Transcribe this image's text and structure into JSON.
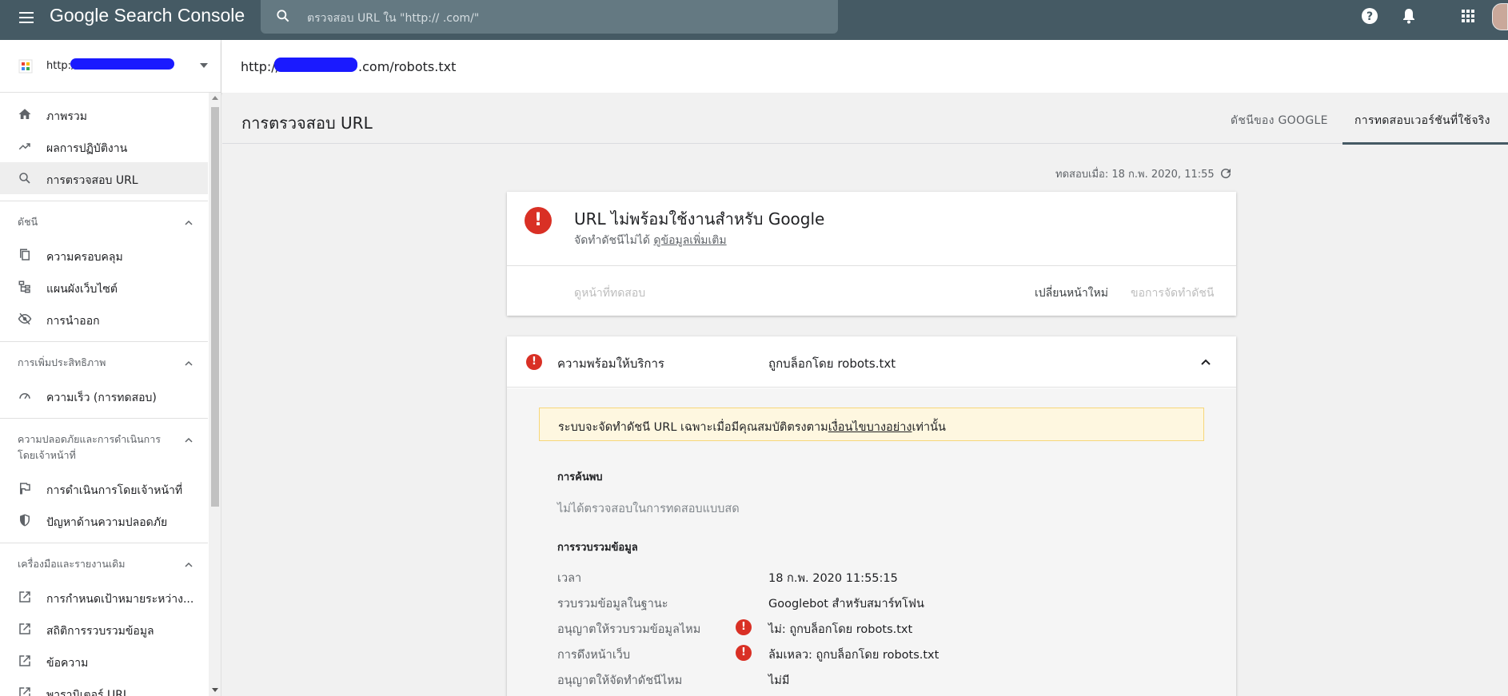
{
  "app": {
    "brand": "Google Search Console"
  },
  "search": {
    "placeholder": "ตรวจสอบ URL ใน \"http://                    .com/\""
  },
  "property": {
    "url": "http://"
  },
  "inspected_url": {
    "prefix": "http://",
    "suffix": ".com/robots.txt"
  },
  "sidebar": {
    "top_items": [
      {
        "label": "ภาพรวม",
        "icon": "home-icon"
      },
      {
        "label": "ผลการปฏิบัติงาน",
        "icon": "trending-up-icon"
      },
      {
        "label": "การตรวจสอบ URL",
        "icon": "search-icon"
      }
    ],
    "sections": [
      {
        "title": "ดัชนี",
        "items": [
          {
            "label": "ความครอบคลุม",
            "icon": "copy-icon"
          },
          {
            "label": "แผนผังเว็บไซต์",
            "icon": "sitemap-icon"
          },
          {
            "label": "การนำออก",
            "icon": "eye-off-icon"
          }
        ]
      },
      {
        "title": "การเพิ่มประสิทธิภาพ",
        "items": [
          {
            "label": "ความเร็ว (การทดสอบ)",
            "icon": "speed-icon"
          }
        ]
      },
      {
        "title": "ความปลอดภัยและการดำเนินการโดยเจ้าหน้าที่",
        "items": [
          {
            "label": "การดำเนินการโดยเจ้าหน้าที่",
            "icon": "flag-icon"
          },
          {
            "label": "ปัญหาด้านความปลอดภัย",
            "icon": "shield-icon"
          }
        ]
      },
      {
        "title": "เครื่องมือและรายงานเดิม",
        "items": [
          {
            "label": "การกำหนดเป้าหมายระหว่าง...",
            "icon": "external-link-icon"
          },
          {
            "label": "สถิติการรวบรวมข้อมูล",
            "icon": "external-link-icon"
          },
          {
            "label": "ข้อความ",
            "icon": "external-link-icon"
          },
          {
            "label": "พารามิเตอร์ URL",
            "icon": "external-link-icon"
          }
        ]
      }
    ]
  },
  "main": {
    "title": "การตรวจสอบ URL",
    "tabs": [
      "ดัชนีของ GOOGLE",
      "การทดสอบเวอร์ชันที่ใช้จริง"
    ],
    "tested_at": "ทดสอบเมื่อ: 18 ก.พ. 2020, 11:55"
  },
  "status_card": {
    "title": "URL ไม่พร้อมใช้งานสำหรับ Google",
    "subtitle": "จัดทำดัชนีไม่ได้ ",
    "learn_more": "ดูข้อมูลเพิ่มเติม",
    "view_tested_page": "ดูหน้าที่ทดสอบ",
    "reload": "เปลี่ยนหน้าใหม่",
    "request_indexing": "ขอการจัดทำดัชนี"
  },
  "coverage": {
    "label": "ความพร้อมให้บริการ",
    "value": "ถูกบล็อกโดย robots.txt",
    "notice_before": "ระบบจะจัดทำดัชนี URL เฉพาะเมื่อมีคุณสมบัติตรงตาม",
    "notice_link": "เงื่อนไขบางอย่าง",
    "notice_after": "เท่านั้น",
    "discovery": {
      "heading": "การค้นพบ",
      "text": "ไม่ได้ตรวจสอบในการทดสอบแบบสด"
    },
    "crawl": {
      "heading": "การรวบรวมข้อมูล",
      "rows": [
        {
          "label": "เวลา",
          "value": "18 ก.พ. 2020 11:55:15",
          "error": false
        },
        {
          "label": "รวบรวมข้อมูลในฐานะ",
          "value": "Googlebot สำหรับสมาร์ทโฟน",
          "error": false
        },
        {
          "label": "อนุญาตให้รวบรวมข้อมูลไหม",
          "value": "ไม่: ถูกบล็อกโดย robots.txt",
          "error": true
        },
        {
          "label": "การดึงหน้าเว็บ",
          "value": "ล้มเหลว: ถูกบล็อกโดย robots.txt",
          "error": true
        },
        {
          "label": "อนุญาตให้จัดทำดัชนีไหม",
          "value": "ไม่มี",
          "error": false
        }
      ]
    }
  },
  "colors": {
    "topbar": "#455a64",
    "error": "#d93025",
    "notice_bg": "#fef7e0"
  }
}
